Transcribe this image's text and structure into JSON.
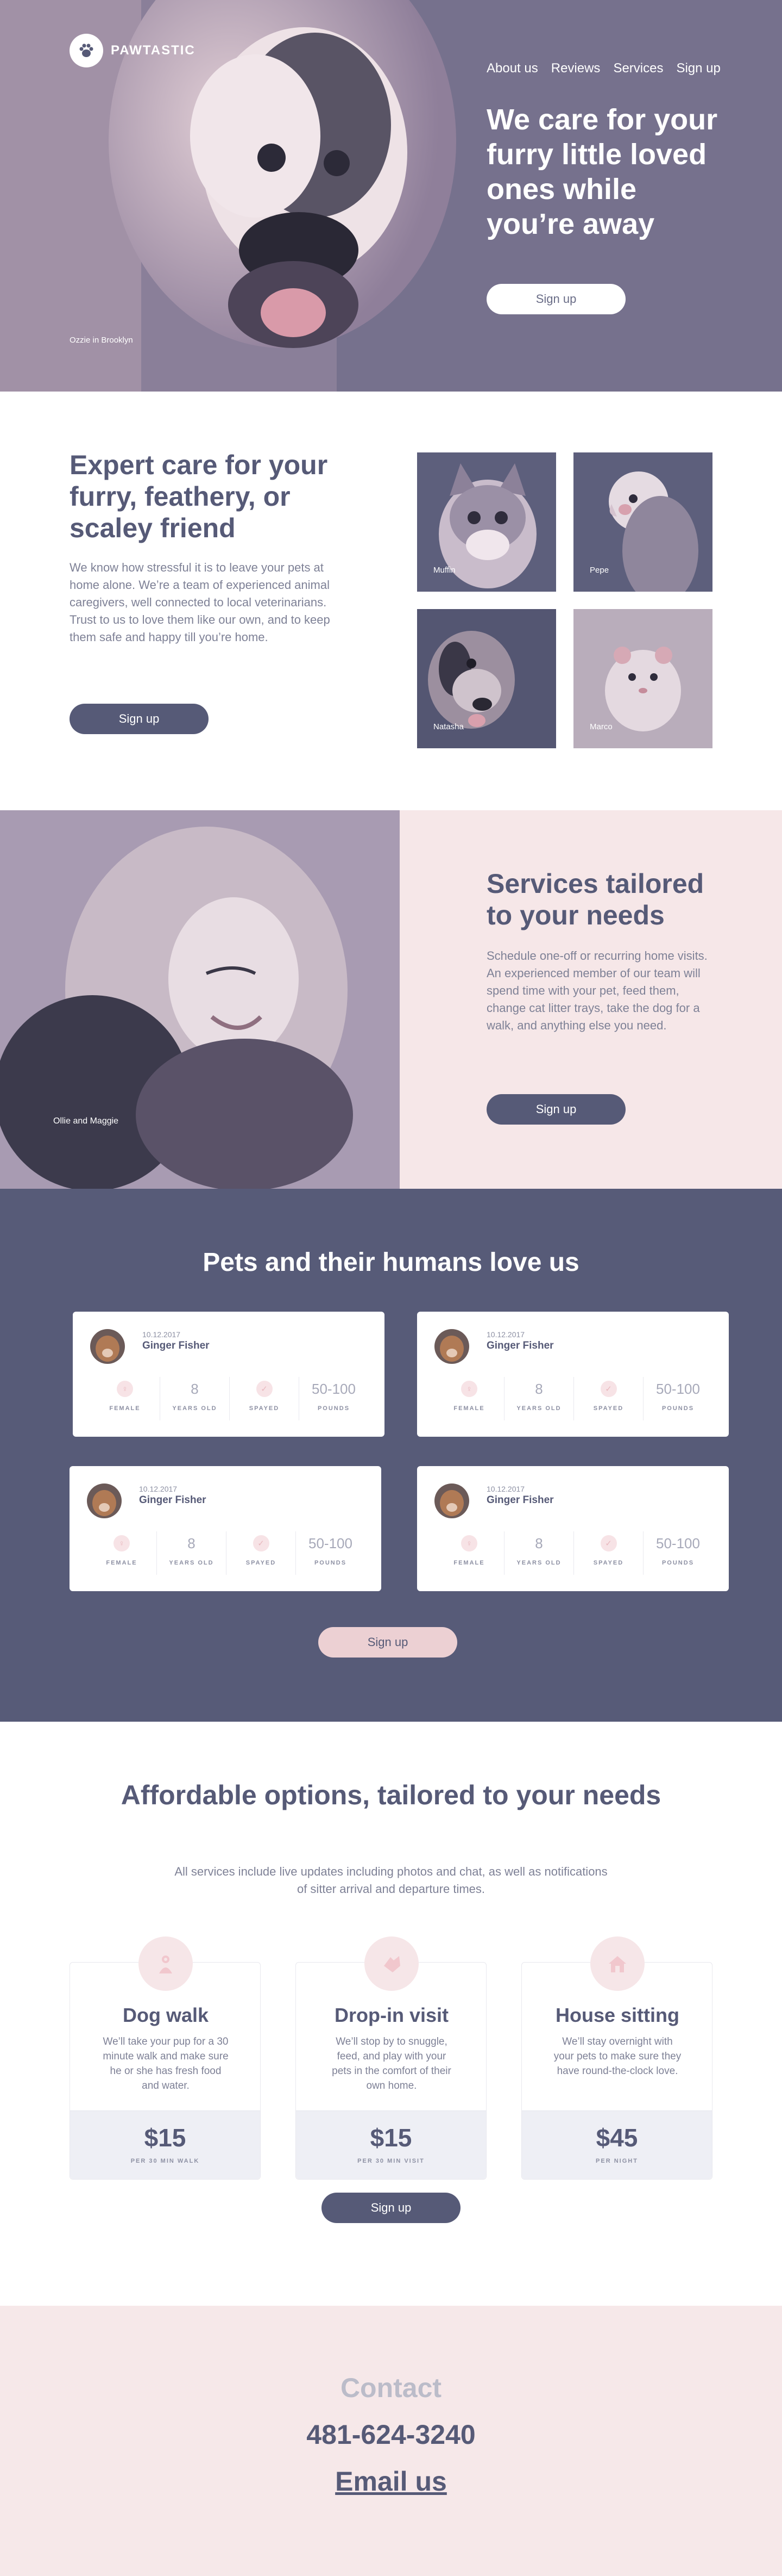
{
  "brand": {
    "name": "PAWTASTIC"
  },
  "nav": [
    "About us",
    "Reviews",
    "Services",
    "Sign up"
  ],
  "hero": {
    "title": "We care for your furry little loved ones while you’re away",
    "button": "Sign up",
    "caption": "Ozzie in Brooklyn"
  },
  "expert": {
    "title": "Expert care for your furry, feathery, or scaley friend",
    "body": "We know how stressful it is to leave your pets at home alone. We’re a team of experienced animal caregivers, well connected to local veterinarians. Trust to us to love them like our own, and to keep them safe and happy till you’re home.",
    "button": "Sign up",
    "pets": [
      "Muffin",
      "Pepe",
      "Natasha",
      "Marco"
    ]
  },
  "tailored": {
    "title": "Services tailored to your needs",
    "body": "Schedule one-off or recurring home visits. An experienced member of our team will spend time with your pet, feed them, change cat litter trays, take the dog for a walk, and anything else you need.",
    "button": "Sign up",
    "caption": "Ollie and Maggie"
  },
  "reviews": {
    "title": "Pets and their humans love us",
    "button": "Sign up",
    "items": [
      {
        "date": "10.12.2017",
        "name": "Ginger Fisher",
        "stats": [
          {
            "value": "",
            "label": "FEMALE",
            "icon": "female-icon"
          },
          {
            "value": "8",
            "label": "YEARS OLD"
          },
          {
            "value": "",
            "label": "SPAYED",
            "icon": "check-icon"
          },
          {
            "value": "50-100",
            "label": "POUNDS"
          }
        ]
      },
      {
        "date": "10.12.2017",
        "name": "Ginger Fisher",
        "stats": [
          {
            "value": "",
            "label": "FEMALE",
            "icon": "female-icon"
          },
          {
            "value": "8",
            "label": "YEARS OLD"
          },
          {
            "value": "",
            "label": "SPAYED",
            "icon": "check-icon"
          },
          {
            "value": "50-100",
            "label": "POUNDS"
          }
        ]
      },
      {
        "date": "10.12.2017",
        "name": "Ginger Fisher",
        "stats": [
          {
            "value": "",
            "label": "FEMALE",
            "icon": "female-icon"
          },
          {
            "value": "8",
            "label": "YEARS OLD"
          },
          {
            "value": "",
            "label": "SPAYED",
            "icon": "check-icon"
          },
          {
            "value": "50-100",
            "label": "POUNDS"
          }
        ]
      },
      {
        "date": "10.12.2017",
        "name": "Ginger Fisher",
        "stats": [
          {
            "value": "",
            "label": "FEMALE",
            "icon": "female-icon"
          },
          {
            "value": "8",
            "label": "YEARS OLD"
          },
          {
            "value": "",
            "label": "SPAYED",
            "icon": "check-icon"
          },
          {
            "value": "50-100",
            "label": "POUNDS"
          }
        ]
      }
    ]
  },
  "pricing": {
    "title": "Affordable options, tailored to your needs",
    "subtitle": "All services include live updates including photos and chat, as well as notifications of sitter arrival and departure times.",
    "button": "Sign up",
    "plans": [
      {
        "name": "Dog walk",
        "desc": "We’ll take your pup for a 30 minute walk and make sure he or she has fresh food and water.",
        "price": "$15",
        "unit": "PER 30 MIN WALK",
        "icon": "dog-walk-icon"
      },
      {
        "name": "Drop-in visit",
        "desc": "We’ll stop by to snuggle, feed, and play with your pets in the comfort of their own home.",
        "price": "$15",
        "unit": "PER 30 MIN VISIT",
        "icon": "paw-hand-icon"
      },
      {
        "name": "House sitting",
        "desc": "We’ll stay overnight with your pets to make sure they have round-the-clock love.",
        "price": "$45",
        "unit": "PER NIGHT",
        "icon": "house-icon"
      }
    ]
  },
  "contact": {
    "title": "Contact",
    "phone": "481-624-3240",
    "email": "Email us"
  }
}
